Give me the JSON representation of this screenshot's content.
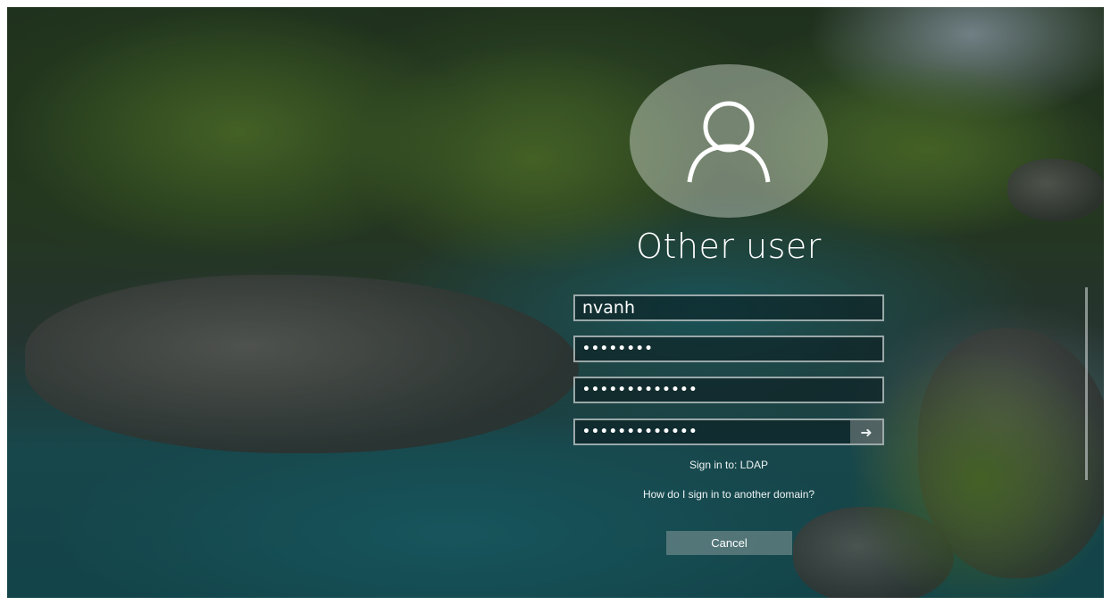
{
  "login": {
    "user_title": "Other user",
    "username_value": "nvanh",
    "password_masked": "••••••••",
    "new_password_masked": "•••••••••••••",
    "confirm_password_masked": "•••••••••••••",
    "sign_in_to": "Sign in to: LDAP",
    "other_domain_link": "How do I sign in to another domain?",
    "cancel_label": "Cancel"
  },
  "icons": {
    "avatar": "user-silhouette-icon",
    "submit": "arrow-right-icon"
  },
  "colors": {
    "text": "#ffffff",
    "field_border": "#c8d2d2"
  }
}
